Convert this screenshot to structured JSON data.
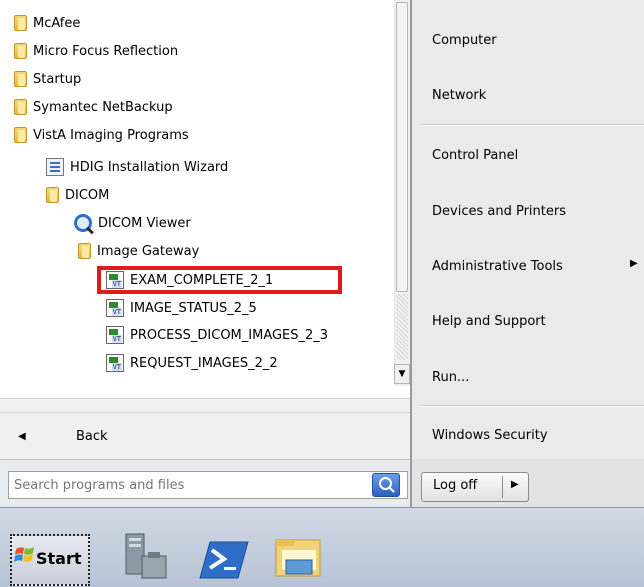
{
  "program_list": [
    {
      "label": "McAfee",
      "icon": "folder-icon",
      "indent": 0
    },
    {
      "label": "Micro Focus Reflection",
      "icon": "folder-icon",
      "indent": 0
    },
    {
      "label": "Startup",
      "icon": "folder-icon",
      "indent": 0
    },
    {
      "label": "Symantec NetBackup",
      "icon": "folder-icon",
      "indent": 0
    },
    {
      "label": "VistA Imaging Programs",
      "icon": "folder-icon",
      "indent": 0
    },
    {
      "label": "HDIG Installation Wizard",
      "icon": "wizard-icon",
      "indent": 1
    },
    {
      "label": "DICOM",
      "icon": "folder-icon",
      "indent": 1
    },
    {
      "label": "DICOM Viewer",
      "icon": "magnifier-icon",
      "indent": 2
    },
    {
      "label": "Image Gateway",
      "icon": "folder-icon",
      "indent": 2
    },
    {
      "label": "EXAM_COMPLETE_2_1",
      "icon": "script-icon",
      "indent": 3
    },
    {
      "label": "IMAGE_STATUS_2_5",
      "icon": "script-icon",
      "indent": 3
    },
    {
      "label": "PROCESS_DICOM_IMAGES_2_3",
      "icon": "script-icon",
      "indent": 3
    },
    {
      "label": "REQUEST_IMAGES_2_2",
      "icon": "script-icon",
      "indent": 3
    }
  ],
  "back": {
    "label": "Back"
  },
  "search": {
    "value": "",
    "placeholder": "Search programs and files"
  },
  "right_menu": [
    {
      "label": "Computer"
    },
    {
      "label": "Network"
    },
    {
      "label": "Control Panel"
    },
    {
      "label": "Devices and Printers"
    },
    {
      "label": "Administrative Tools"
    },
    {
      "label": "Help and Support"
    },
    {
      "label": "Run..."
    },
    {
      "label": "Windows Security"
    }
  ],
  "logoff": {
    "label": "Log off"
  },
  "start": {
    "label": "Start"
  },
  "taskbar": {
    "items": [
      "server-manager-icon",
      "powershell-icon",
      "explorer-icon"
    ]
  },
  "colors": {
    "highlight": "#e01b1b",
    "menu_bg": "#eaeaea",
    "taskbar": "#c4cedb"
  }
}
